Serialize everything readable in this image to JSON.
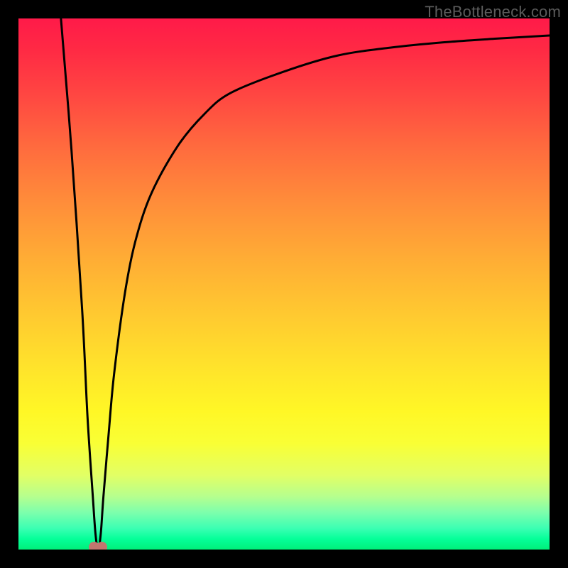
{
  "watermark": "TheBottleneck.com",
  "chart_data": {
    "type": "line",
    "title": "",
    "xlabel": "",
    "ylabel": "",
    "xlim": [
      0,
      100
    ],
    "ylim": [
      0,
      100
    ],
    "grid": false,
    "legend": false,
    "axes_visible": false,
    "background": "vertical-gradient-heatmap",
    "gradient_stops": [
      {
        "pct": 0,
        "color": "#ff1a49"
      },
      {
        "pct": 24,
        "color": "#ff6a3e"
      },
      {
        "pct": 56,
        "color": "#ffca30"
      },
      {
        "pct": 80,
        "color": "#f9ff35"
      },
      {
        "pct": 96,
        "color": "#3bffb3"
      },
      {
        "pct": 100,
        "color": "#00f07a"
      }
    ],
    "series": [
      {
        "name": "bottleneck-curve",
        "x": [
          8,
          10,
          12,
          13,
          14,
          14.5,
          15,
          15.5,
          16,
          17,
          18,
          20,
          22,
          25,
          30,
          35,
          40,
          50,
          60,
          70,
          80,
          90,
          100
        ],
        "y": [
          100,
          75,
          45,
          25,
          10,
          3,
          0,
          3,
          10,
          22,
          33,
          48,
          58,
          67,
          76,
          82,
          86,
          90,
          93,
          94.5,
          95.5,
          96.2,
          96.8
        ]
      }
    ],
    "marker": {
      "x": 15,
      "y": 0,
      "shape": "double-dot",
      "color": "#c1766f"
    }
  }
}
